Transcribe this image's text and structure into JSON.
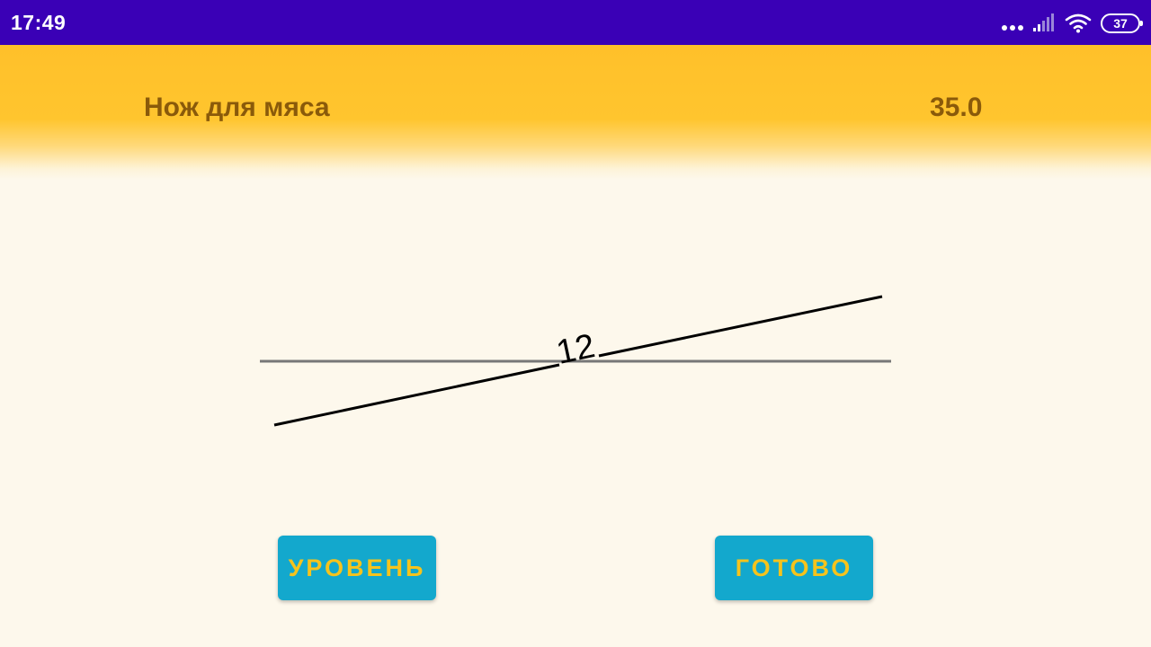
{
  "status_bar": {
    "time": "17:49",
    "battery_level": "37",
    "icons": [
      "more-dots-icon",
      "signal-icon",
      "wifi-icon",
      "battery-icon"
    ]
  },
  "header": {
    "title": "Нож для мяса",
    "value": "35.0"
  },
  "angle_gauge": {
    "angle_label": "12",
    "angle_degrees": 12
  },
  "buttons": {
    "level_label": "УРОВЕНЬ",
    "done_label": "ГОТОВО"
  },
  "colors": {
    "status_bar": "#3a00b6",
    "header": "#ffc52e",
    "background": "#fdf8ec",
    "button": "#13a8cd",
    "button_text": "#f6c31c",
    "header_text": "#8a5a0a"
  }
}
